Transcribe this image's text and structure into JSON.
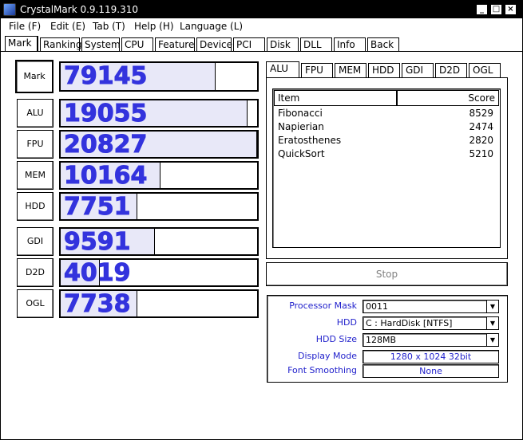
{
  "titlebar": {
    "title": "CrystalMark 0.9.119.310",
    "min": "_",
    "max": "□",
    "close": "×"
  },
  "menu": [
    "File (F)",
    "Edit (E)",
    "Tab (T)",
    "Help (H)",
    "Language (L)"
  ],
  "tabs": [
    "Mark",
    "Ranking",
    "System",
    "CPU",
    "Feature",
    "Device",
    "PCI",
    "Disk",
    "DLL",
    "Info",
    "Back"
  ],
  "scores": [
    {
      "label": "Mark",
      "value": "79145",
      "fill": 0.79
    },
    {
      "label": "ALU",
      "value": "19055",
      "fill": 0.95
    },
    {
      "label": "FPU",
      "value": "20827",
      "fill": 1.0
    },
    {
      "label": "MEM",
      "value": "10164",
      "fill": 0.51
    },
    {
      "label": "HDD",
      "value": "7751",
      "fill": 0.39
    },
    {
      "label": "GDI",
      "value": "9591",
      "fill": 0.48
    },
    {
      "label": "D2D",
      "value": "4019",
      "fill": 0.2
    },
    {
      "label": "OGL",
      "value": "7738",
      "fill": 0.39
    }
  ],
  "subtabs": [
    "ALU",
    "FPU",
    "MEM",
    "HDD",
    "GDI",
    "D2D",
    "OGL"
  ],
  "list": {
    "col_item": "Item",
    "col_score": "Score",
    "rows": [
      {
        "name": "Fibonacci",
        "score": "8529"
      },
      {
        "name": "Napierian",
        "score": "2474"
      },
      {
        "name": "Eratosthenes",
        "score": "2820"
      },
      {
        "name": "QuickSort",
        "score": "5210"
      }
    ]
  },
  "stop_label": "Stop",
  "options": {
    "processor_mask_label": "Processor Mask",
    "processor_mask_value": "0011",
    "hdd_label": "HDD",
    "hdd_value": "C : HardDisk [NTFS]",
    "hdd_size_label": "HDD Size",
    "hdd_size_value": "128MB",
    "display_mode_label": "Display Mode",
    "display_mode_value": "1280 x 1024 32bit",
    "font_smoothing_label": "Font Smoothing",
    "font_smoothing_value": "None"
  },
  "colors": {
    "score_text": "#3333dd",
    "label_text": "#2222cc"
  }
}
